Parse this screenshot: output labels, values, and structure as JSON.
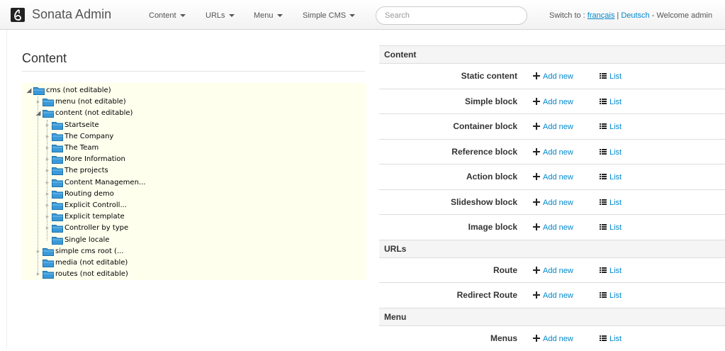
{
  "navbar": {
    "brand": "Sonata Admin",
    "menus": [
      {
        "label": "Content"
      },
      {
        "label": "URLs"
      },
      {
        "label": "Menu"
      },
      {
        "label": "Simple CMS"
      }
    ],
    "search_placeholder": "Search",
    "locale_prefix": "Switch to : ",
    "locale_fr": "français",
    "locale_sep": " | ",
    "locale_de": "Deutsch",
    "welcome": " - Welcome admin"
  },
  "left": {
    "title": "Content",
    "tree": [
      {
        "label": "cms (not editable)",
        "level": 0,
        "toggle": "expanded"
      },
      {
        "label": "menu (not editable)",
        "level": 1,
        "toggle": "collapsed"
      },
      {
        "label": "content (not editable)",
        "level": 1,
        "toggle": "expanded"
      },
      {
        "label": "Startseite",
        "level": 2,
        "toggle": "collapsed"
      },
      {
        "label": "The Company",
        "level": 2,
        "toggle": "collapsed"
      },
      {
        "label": "The Team",
        "level": 2,
        "toggle": "collapsed"
      },
      {
        "label": "More Information",
        "level": 2,
        "toggle": "collapsed"
      },
      {
        "label": "The projects",
        "level": 2,
        "toggle": "collapsed"
      },
      {
        "label": "Content Managemen...",
        "level": 2,
        "toggle": "collapsed"
      },
      {
        "label": "Routing demo",
        "level": 2,
        "toggle": "collapsed"
      },
      {
        "label": "Explicit Controll...",
        "level": 2,
        "toggle": "collapsed"
      },
      {
        "label": "Explicit template",
        "level": 2,
        "toggle": "collapsed"
      },
      {
        "label": "Controller by type",
        "level": 2,
        "toggle": "collapsed"
      },
      {
        "label": "Single locale",
        "level": 2,
        "toggle": "leaf"
      },
      {
        "label": "simple cms root (...",
        "level": 1,
        "toggle": "collapsed"
      },
      {
        "label": "media (not editable)",
        "level": 1,
        "toggle": "leaf"
      },
      {
        "label": "routes (not editable)",
        "level": 1,
        "toggle": "collapsed"
      }
    ]
  },
  "dashboard": {
    "add_label": "Add new",
    "list_label": "List",
    "sections": [
      {
        "title": "Content",
        "items": [
          "Static content",
          "Simple block",
          "Container block",
          "Reference block",
          "Action block",
          "Slideshow block",
          "Image block"
        ]
      },
      {
        "title": "URLs",
        "items": [
          "Route",
          "Redirect Route"
        ]
      },
      {
        "title": "Menu",
        "items": [
          "Menus"
        ]
      }
    ]
  },
  "colors": {
    "link": "#0088cc",
    "tree_bg": "#ffffee",
    "section_bg": "#f5f5f5",
    "folder": "#3a9ad9"
  }
}
